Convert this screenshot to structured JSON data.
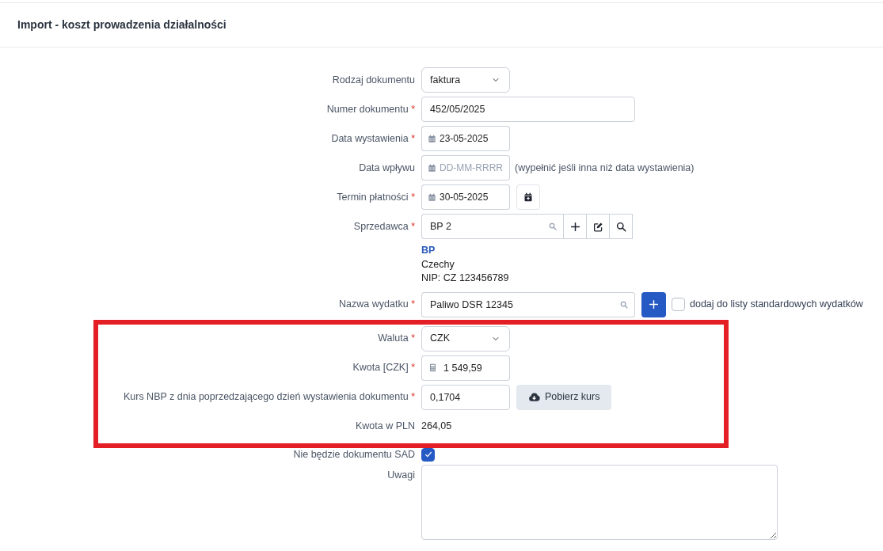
{
  "page": {
    "title": "Import - koszt prowadzenia działalności"
  },
  "sections": [
    {
      "highlighted": false,
      "fields": [
        {
          "kind": "select",
          "label": "Rodzaj dokumentu",
          "value": "faktura"
        },
        {
          "kind": "text",
          "label": "Numer dokumentu",
          "required_mark": "*",
          "value": "452/05/2025"
        },
        {
          "kind": "date",
          "label": "Data wystawienia",
          "required_mark": "*",
          "value": "23-05-2025"
        },
        {
          "kind": "date",
          "label": "Data wpływu",
          "placeholder": "DD-MM-RRRR",
          "hint": "(wypełnić jeśli inna niż data wystawienia)"
        },
        {
          "kind": "date",
          "label": "Termin płatności",
          "required_mark": "*",
          "value": "30-05-2025",
          "calendar_button": true
        },
        {
          "kind": "lookup",
          "label": "Sprzedawca",
          "required_mark": "*",
          "value": "BP 2",
          "actions": [
            {
              "kind": "add"
            },
            {
              "kind": "edit"
            },
            {
              "kind": "search"
            }
          ]
        },
        {
          "kind": "info",
          "name": "BP",
          "lines": [
            "Czechy",
            "NIP: CZ 123456789"
          ]
        },
        {
          "kind": "expense",
          "label": "Nazwa wydatku",
          "required_mark": "*",
          "value": "Paliwo DSR 12345",
          "checkbox": {
            "label": "dodaj do listy standardowych wydatków",
            "checked": false
          }
        }
      ]
    },
    {
      "highlighted": true,
      "fields": [
        {
          "kind": "select",
          "label": "Waluta",
          "required_mark": "*",
          "value": "CZK"
        },
        {
          "kind": "amount",
          "label": "Kwota [CZK]",
          "required_mark": "*",
          "value": "1 549,59"
        },
        {
          "kind": "rate",
          "label": "Kurs NBP z dnia poprzedzającego dzień wystawienia dokumentu",
          "required_mark": "*",
          "value": "0,1704",
          "button": "Pobierz kurs"
        },
        {
          "kind": "static",
          "label": "Kwota w PLN",
          "value": "264,05"
        }
      ]
    },
    {
      "highlighted": false,
      "fields": [
        {
          "kind": "checkbox",
          "label": "Nie będzie dokumentu SAD",
          "checked": true
        },
        {
          "kind": "textarea",
          "label": "Uwagi"
        }
      ]
    }
  ]
}
